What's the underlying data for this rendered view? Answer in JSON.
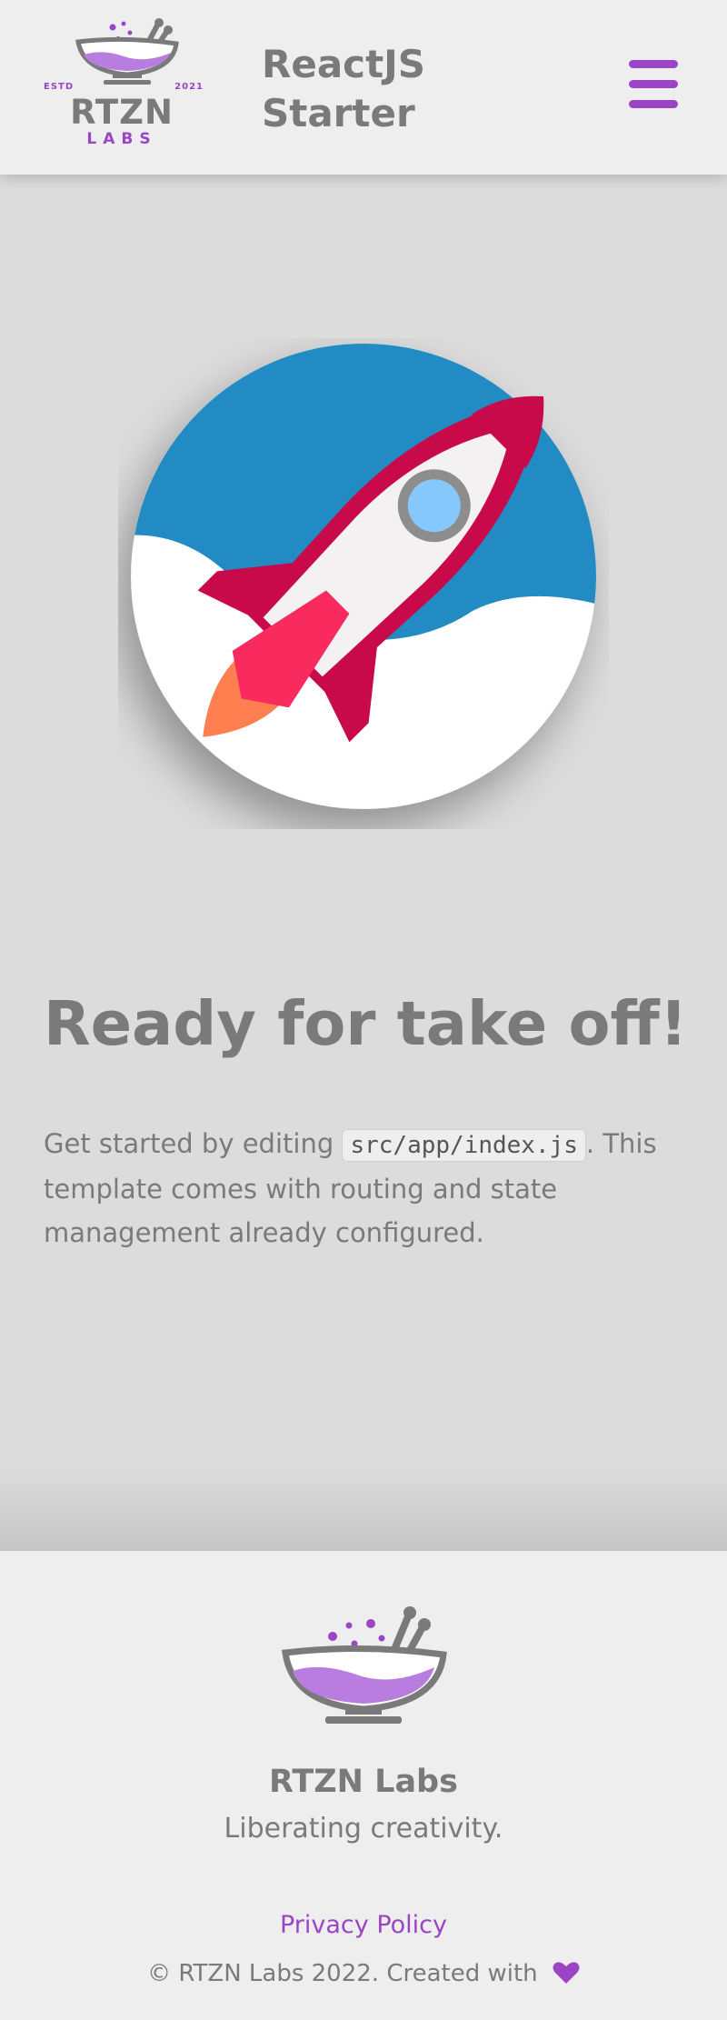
{
  "header": {
    "logo": {
      "estd": "ESTD",
      "year": "2021",
      "name": "RTZN",
      "labs": "LABS",
      "icon": "mortar-pestle-icon"
    },
    "title_line1": "ReactJS",
    "title_line2": "Starter",
    "menu_icon": "hamburger-menu-icon"
  },
  "hero": {
    "illustration": "rocket-launch-icon",
    "title": "Ready for take off!",
    "text_before_code": "Get started by editing ",
    "code": "src/app/index.js",
    "text_after_code": ". This template comes with routing and state management already configured."
  },
  "footer": {
    "logo_icon": "mortar-pestle-icon",
    "name": "RTZN Labs",
    "tagline": "Liberating creativity.",
    "privacy_link": "Privacy Policy",
    "copyright": "© RTZN Labs 2022. Created with",
    "heart_icon": "heart-icon"
  },
  "colors": {
    "accent": "#9b45c6",
    "text": "#7a7a7a",
    "header_bg": "#eeeeee",
    "page_bg": "#dcdcdc",
    "rocket_sky": "#228bc4",
    "rocket_body": "#f3f1f1",
    "rocket_red": "#c90a4a",
    "rocket_fin": "#f82a5e",
    "rocket_flame": "#ff7f50",
    "rocket_window": "#87c8fc"
  }
}
